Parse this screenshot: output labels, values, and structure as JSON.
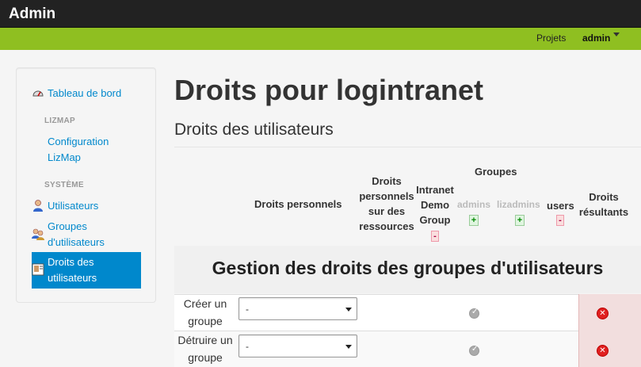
{
  "app": {
    "brand": "Admin"
  },
  "topnav": {
    "projects": "Projets",
    "user": "admin"
  },
  "sidebar": {
    "dashboard": "Tableau de bord",
    "lizmap_header": "LIZMAP",
    "configuration": "Configuration LizMap",
    "system_header": "SYSTÈME",
    "users": "Utilisateurs",
    "user_groups": "Groupes d'utilisateurs",
    "user_rights": "Droits des utilisateurs"
  },
  "page": {
    "title": "Droits pour logintranet",
    "subtitle": "Droits des utilisateurs"
  },
  "table": {
    "col_personal": "Droits personnels",
    "col_personal_resources": "Droits personnels sur des ressources",
    "col_groups": "Groupes",
    "col_intranet": "Intranet Demo Group",
    "col_admins": "admins",
    "col_lizadmins": "lizadmins",
    "col_users": "users",
    "col_result": "Droits résultants",
    "plus": "+",
    "minus": "-",
    "section_title": "Gestion des droits des groupes d'utilisateurs",
    "rows": [
      {
        "label": "Créer un groupe",
        "value": "-"
      },
      {
        "label": "Détruire un groupe",
        "value": "-"
      }
    ]
  },
  "colors": {
    "accent": "#0088cc",
    "greenbar": "#8fbf21",
    "topbar": "#222222",
    "deny": "#e02020"
  }
}
